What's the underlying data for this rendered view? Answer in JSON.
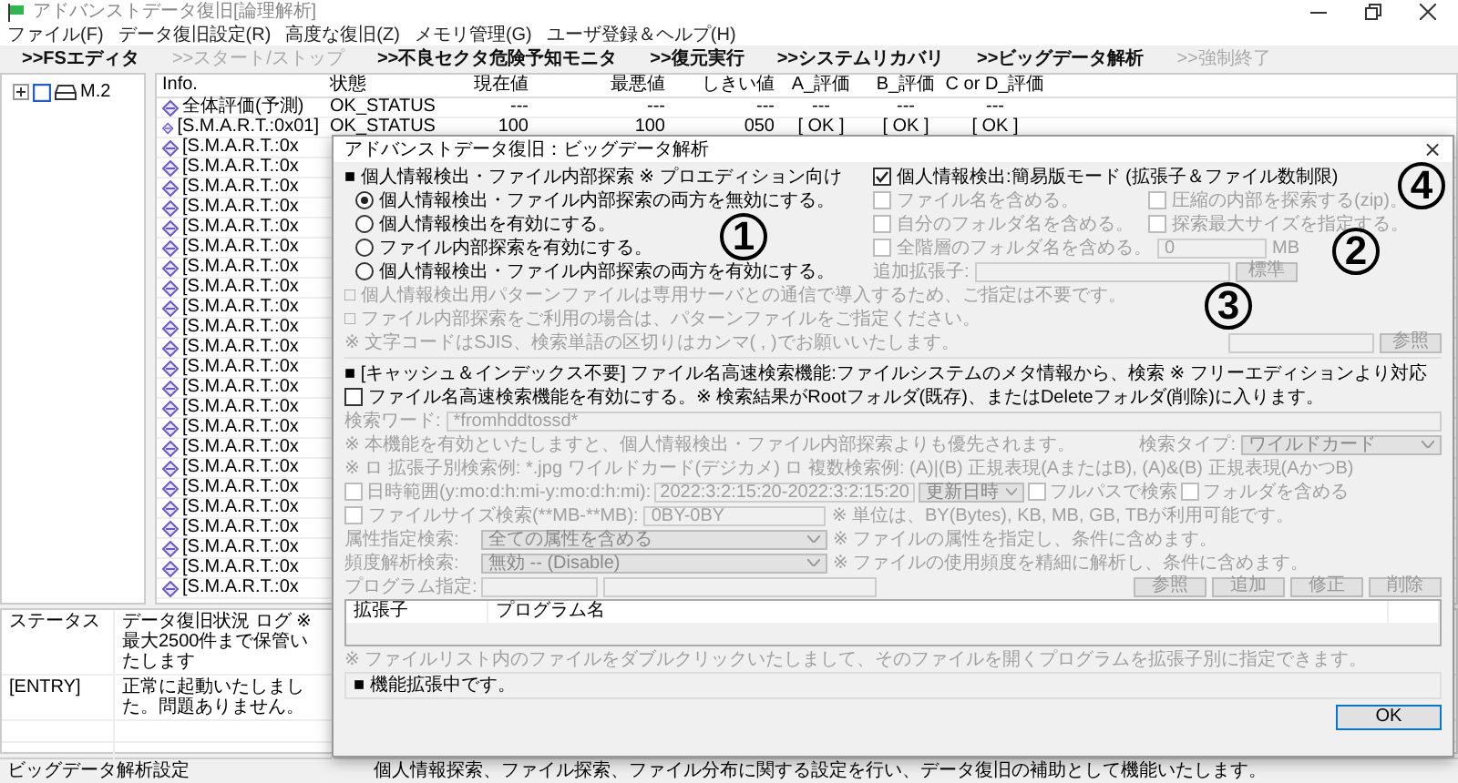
{
  "window": {
    "title": "アドバンストデータ復旧[論理解析]"
  },
  "menu": [
    "ファイル(F)",
    "データ復旧設定(R)",
    "高度な復旧(Z)",
    "メモリ管理(G)",
    "ユーザ登録＆ヘルプ(H)"
  ],
  "toolbar": [
    {
      "label": ">>FSエディタ",
      "disabled": false
    },
    {
      "label": ">>スタート/ストップ",
      "disabled": true
    },
    {
      "label": ">>不良セクタ危険予知モニタ",
      "disabled": false
    },
    {
      "label": ">>復元実行",
      "disabled": false
    },
    {
      "label": ">>システムリカバリ",
      "disabled": false
    },
    {
      "label": ">>ビッグデータ解析",
      "disabled": false
    },
    {
      "label": ">>強制終了",
      "disabled": true
    }
  ],
  "tree": [
    {
      "label": "M.2"
    }
  ],
  "table": {
    "columns": [
      "Info.",
      "状態",
      "現在値",
      "最悪値",
      "しきい値",
      "A_評価",
      "B_評価",
      "C or D_評価"
    ],
    "rows": [
      {
        "cells": [
          "全体評価(予測)",
          "OK_STATUS",
          "---",
          "---",
          "---",
          "---",
          "---",
          "---"
        ]
      },
      {
        "cells": [
          "[S.M.A.R.T.:0x01]",
          "OK_STATUS",
          "100",
          "100",
          "050",
          "[ OK ]",
          "[ OK ]",
          "[ OK ]"
        ]
      },
      {
        "cells": [
          "[S.M.A.R.T.:0x"
        ]
      },
      {
        "cells": [
          "[S.M.A.R.T.:0x"
        ]
      },
      {
        "cells": [
          "[S.M.A.R.T.:0x"
        ]
      },
      {
        "cells": [
          "[S.M.A.R.T.:0x"
        ]
      },
      {
        "cells": [
          "[S.M.A.R.T.:0x"
        ]
      },
      {
        "cells": [
          "[S.M.A.R.T.:0x"
        ]
      },
      {
        "cells": [
          "[S.M.A.R.T.:0x"
        ]
      },
      {
        "cells": [
          "[S.M.A.R.T.:0x"
        ]
      },
      {
        "cells": [
          "[S.M.A.R.T.:0x"
        ]
      },
      {
        "cells": [
          "[S.M.A.R.T.:0x"
        ]
      },
      {
        "cells": [
          "[S.M.A.R.T.:0x"
        ]
      },
      {
        "cells": [
          "[S.M.A.R.T.:0x"
        ]
      },
      {
        "cells": [
          "[S.M.A.R.T.:0x"
        ]
      },
      {
        "cells": [
          "[S.M.A.R.T.:0x"
        ]
      },
      {
        "cells": [
          "[S.M.A.R.T.:0x"
        ]
      },
      {
        "cells": [
          "[S.M.A.R.T.:0x"
        ]
      },
      {
        "cells": [
          "[S.M.A.R.T.:0x"
        ]
      },
      {
        "cells": [
          "[S.M.A.R.T.:0x"
        ]
      },
      {
        "cells": [
          "[S.M.A.R.T.:0x"
        ]
      },
      {
        "cells": [
          "[S.M.A.R.T.:0x"
        ]
      },
      {
        "cells": [
          "[S.M.A.R.T.:0x"
        ]
      },
      {
        "cells": [
          "[S.M.A.R.T.:0x"
        ]
      },
      {
        "cells": [
          "[S.M.A.R.T.:0x"
        ]
      }
    ]
  },
  "log": {
    "columns": [
      "ステータス",
      "データ復旧状況 ログ ※ 最大2500件まで保管いたします"
    ],
    "rows": [
      {
        "cells": [
          "[ENTRY]",
          "正常に起動いたしました。問題ありません。"
        ]
      }
    ]
  },
  "status_bar": [
    "ビッグデータ解析設定",
    "個人情報探索、ファイル探索、ファイル分布に関する設定を行い、データ復旧の補助として機能いたします。"
  ],
  "dialog": {
    "title": "アドバンストデータ復旧：ビッグデータ解析",
    "close": "×",
    "personal": {
      "heading": "■ 個人情報検出・ファイル内部探索 ※ プロエディション向け",
      "modes": [
        {
          "label": "個人情報検出・ファイル内部探索の両方を無効にする。",
          "selected": true
        },
        {
          "label": "個人情報検出を有効にする。",
          "selected": false
        },
        {
          "label": "ファイル内部探索を有効にする。",
          "selected": false
        },
        {
          "label": "個人情報検出・ファイル内部探索の両方を有効にする。",
          "selected": false
        }
      ],
      "simple_mode": {
        "label": "個人情報検出:簡易版モード (拡張子＆ファイル数制限)",
        "checked": true
      },
      "options": [
        {
          "label": "ファイル名を含める。",
          "checked": false,
          "disabled": true
        },
        {
          "label": "圧縮の内部を探索する(zip)。",
          "checked": false,
          "disabled": true
        },
        {
          "label": "自分のフォルダ名を含める。",
          "checked": false,
          "disabled": true
        },
        {
          "label": "探索最大サイズを指定する。",
          "checked": false,
          "disabled": true
        },
        {
          "label": "全階層のフォルダ名を含める。",
          "checked": false,
          "disabled": true
        }
      ],
      "max_size": {
        "value": "0",
        "unit": "MB"
      },
      "extension": {
        "label": "追加拡張子:",
        "button": "標準"
      },
      "notes": [
        "□ 個人情報検出用パターンファイルは専用サーバとの通信で導入するため、ご指定は不要です。",
        "□ ファイル内部探索をご利用の場合は、パターンファイルをご指定ください。",
        "※ 文字コードはSJIS、検索単語の区切りはカンマ( , )でお願いいたします。"
      ],
      "pattern_button": "参照"
    },
    "fast_search": {
      "heading": "■ [キャッシュ＆インデックス不要] ファイル名高速検索機能:ファイルシステムのメタ情報から、検索 ※ フリーエディションより対応",
      "enable": {
        "label": "ファイル名高速検索機能を有効にする。※ 検索結果がRootフォルダ(既存)、またはDeleteフォルダ(削除)に入ります。",
        "checked": false
      },
      "disabled": true,
      "search_word": {
        "label": "検索ワード:",
        "value": "*fromhddtossd*"
      },
      "priority_note": "※ 本機能を有効といたしますと、個人情報検出・ファイル内部探索よりも優先されます。",
      "search_type": {
        "label": "検索タイプ:",
        "value": "ワイルドカード"
      },
      "examples_note": "※ ロ 拡張子別検索例: *.jpg ワイルドカード(デジカメ) ロ 複数検索例: (A)|(B) 正規表現(AまたはB), (A)&(B) 正規表現(AかつB)",
      "date_range": {
        "label": "日時範囲(y:mo:d:h:mi-y:mo:d:h:mi):",
        "checked": false,
        "value": "2022:3:2:15:20-2022:3:2:15:20",
        "mode": "更新日時"
      },
      "full_path": {
        "label": "フルパスで検索",
        "checked": false
      },
      "include_folders": {
        "label": "フォルダを含める",
        "checked": false
      },
      "size_range": {
        "label": "ファイルサイズ検索(**MB-**MB):",
        "checked": false,
        "value": "0BY-0BY",
        "note": "※ 単位は、BY(Bytes), KB, MB, GB, TBが利用可能です。"
      },
      "attribute": {
        "label": "属性指定検索:",
        "value": "全ての属性を含める",
        "note": "※ ファイルの属性を指定し、条件に含めます。"
      },
      "frequency": {
        "label": "頻度解析検索:",
        "value": "無効 -- (Disable)",
        "note": "※ ファイルの使用頻度を精細に解析し、条件に含めます。"
      },
      "program": {
        "label": "プログラム指定:",
        "buttons": [
          "参照",
          "追加",
          "修正",
          "削除"
        ]
      },
      "program_list": {
        "columns": [
          "拡張子",
          "プログラム名"
        ]
      },
      "list_note": "※ ファイルリスト内のファイルをダブルクリックいたしまして、そのファイルを開くプログラムを拡張子別に指定できます。"
    },
    "status": "■ 機能拡張中です。",
    "ok": "OK"
  },
  "annotations": [
    "1",
    "2",
    "3",
    "4"
  ]
}
